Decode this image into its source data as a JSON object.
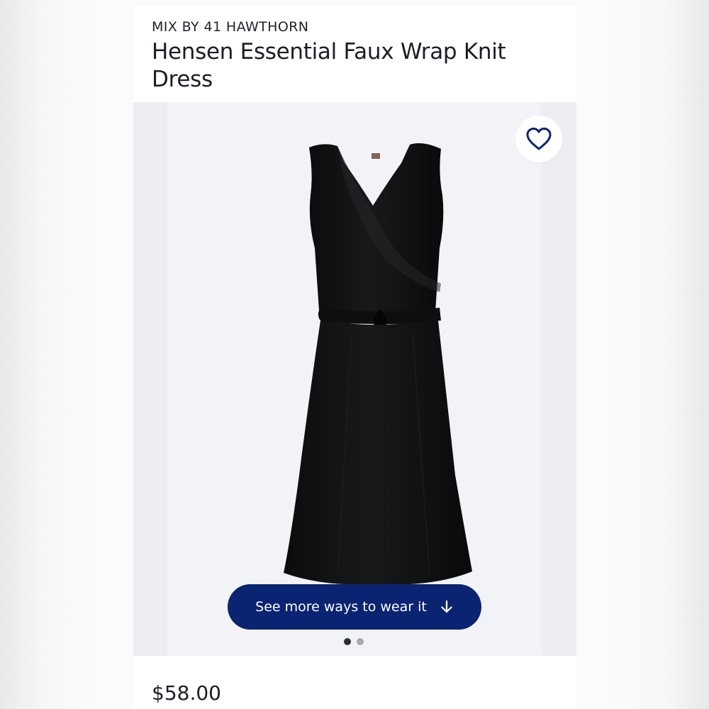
{
  "product": {
    "brand": "MIX BY 41 HAWTHORN",
    "title": "Hensen Essential Faux Wrap Knit Dress",
    "price": "$58.00"
  },
  "actions": {
    "favorite_icon": "heart-outline-icon",
    "wear_button_label": "See more ways to wear it",
    "wear_button_icon": "arrow-down-icon"
  },
  "carousel": {
    "total_slides": 2,
    "active_slide": 1
  },
  "colors": {
    "accent": "#0b2472",
    "text": "#1b1d29",
    "image_background": "#f2f3f6"
  }
}
